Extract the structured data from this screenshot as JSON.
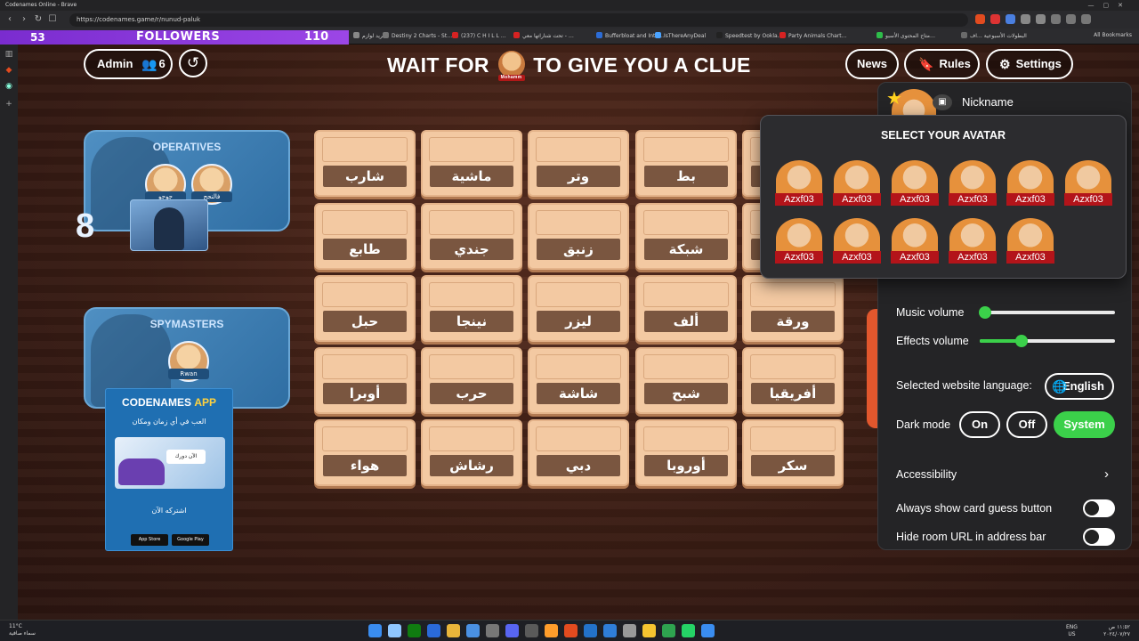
{
  "browser": {
    "window_title": "Codenames Online - Brave",
    "url": "https://codenames.game/r/nunud-paluk",
    "bookmarks": [
      {
        "label": "قوائم المم…",
        "color": "#e23b3b"
      },
      {
        "label": "مختصة في مقال…",
        "color": "#cc2a2a"
      },
      {
        "label": "(7,172) …",
        "color": "#d62222"
      },
      {
        "label": "الفريد لوازم",
        "color": "#888888"
      },
      {
        "label": "Destiny 2 Charts - St…",
        "color": "#777777"
      },
      {
        "label": "(237) C H I L L …",
        "color": "#d62222"
      },
      {
        "label": "تحت شناراتها معي - …",
        "color": "#d62222"
      },
      {
        "label": "Bufferbloat and Inte…",
        "color": "#2c6cd6"
      },
      {
        "label": "IsThereAnyDeal",
        "color": "#4aa3ff"
      },
      {
        "label": "Speedtest by Ookla…",
        "color": "#222222"
      },
      {
        "label": "Party Animals Chart…",
        "color": "#d62222"
      },
      {
        "label": "متاح المحتوى الأسبو…",
        "color": "#2ebd4a"
      },
      {
        "label": "البطولات الأسبوعية …اف",
        "color": "#6a6a6a"
      }
    ],
    "bookmarks_right": "All Bookmarks"
  },
  "stream_overlay": {
    "count_left": "53",
    "label": "FOLLOWERS",
    "count_right": "110"
  },
  "game": {
    "admin_label": "Admin",
    "players_count": "6",
    "news_label": "News",
    "rules_label": "Rules",
    "settings_label": "Settings",
    "headline_prefix": "WAIT FOR",
    "headline_avatar_name": "Mohamm",
    "headline_suffix": "TO GIVE YOU A CLUE",
    "operatives_title": "OPERATIVES",
    "operatives": [
      {
        "name": "جوجو"
      },
      {
        "name": "فالنجح"
      }
    ],
    "score": "8",
    "spymasters_title": "SPYMASTERS",
    "spymasters": [
      {
        "name": "Rwan"
      }
    ],
    "app_ad": {
      "title_main": "CODENAMES",
      "title_accent": "APP",
      "subtitle": "العب في أي زمان ومكان",
      "bubble": "الآن دورك",
      "cta": "اشتركه الآن",
      "store1": "App Store",
      "store2": "Google Play"
    },
    "cards": [
      {
        "word": "شارب"
      },
      {
        "word": "ماشية"
      },
      {
        "word": "وتر"
      },
      {
        "word": "بط"
      },
      {
        "word": ""
      },
      {
        "word": "طابع"
      },
      {
        "word": "جندي"
      },
      {
        "word": "زنبق"
      },
      {
        "word": "شبكة"
      },
      {
        "word": ""
      },
      {
        "word": "حبل"
      },
      {
        "word": "نينجا"
      },
      {
        "word": "ليزر"
      },
      {
        "word": "ألف"
      },
      {
        "word": "ورقة"
      },
      {
        "word": "أوبرا"
      },
      {
        "word": "حرب"
      },
      {
        "word": "شاشة"
      },
      {
        "word": "شبح"
      },
      {
        "word": "أفريقيا"
      },
      {
        "word": "هواء"
      },
      {
        "word": "رشاش"
      },
      {
        "word": "دبي"
      },
      {
        "word": "أوروبا"
      },
      {
        "word": "سكر"
      }
    ]
  },
  "settings": {
    "nickname_label": "Nickname",
    "music_volume_label": "Music volume",
    "music_volume_value": 0,
    "effects_volume_label": "Effects volume",
    "effects_volume_value": 0.31,
    "language_label": "Selected website language:",
    "language_value": "English",
    "dark_mode_label": "Dark mode",
    "dark_mode_options": [
      "On",
      "Off",
      "System"
    ],
    "dark_mode_selected": "System",
    "accessibility_label": "Accessibility",
    "always_show_guess_label": "Always show card guess button",
    "hide_url_label": "Hide room URL in address bar",
    "accent_color": "#3bd04a"
  },
  "avatar_popup": {
    "title": "SELECT YOUR AVATAR",
    "avatars": [
      {
        "tag": "Azxf03"
      },
      {
        "tag": "Azxf03"
      },
      {
        "tag": "Azxf03"
      },
      {
        "tag": "Azxf03"
      },
      {
        "tag": "Azxf03"
      },
      {
        "tag": "Azxf03"
      },
      {
        "tag": "Azxf03"
      },
      {
        "tag": "Azxf03"
      },
      {
        "tag": "Azxf03"
      },
      {
        "tag": "Azxf03"
      },
      {
        "tag": "Azxf03"
      }
    ]
  },
  "taskbar": {
    "weather_temp": "11°C",
    "weather_desc": "سماء صافية",
    "lang_top": "ENG",
    "lang_bottom": "US",
    "time": "١١:٥٢ ص",
    "date": "٢٠٢٤/٠٧/٢٧"
  }
}
